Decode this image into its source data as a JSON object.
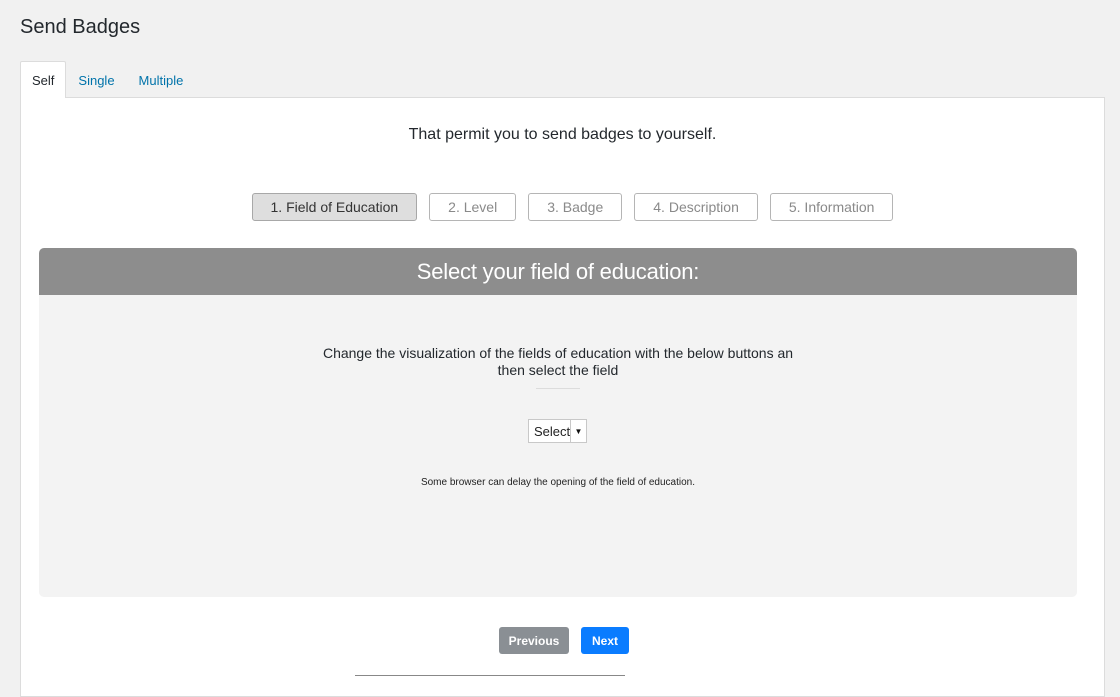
{
  "page": {
    "title": "Send Badges"
  },
  "tabs": [
    {
      "label": "Self",
      "active": true
    },
    {
      "label": "Single",
      "active": false
    },
    {
      "label": "Multiple",
      "active": false
    }
  ],
  "intro": "That permit you to send badges to yourself.",
  "steps": [
    {
      "label": "1. Field of Education",
      "active": true
    },
    {
      "label": "2. Level",
      "active": false
    },
    {
      "label": "3. Badge",
      "active": false
    },
    {
      "label": "4. Description",
      "active": false
    },
    {
      "label": "5. Information",
      "active": false
    }
  ],
  "card": {
    "header": "Select your field of education:",
    "description": "Change the visualization of the fields of education with the below buttons an then select the field",
    "select_value": "Select",
    "note": "Some browser can delay the opening of the field of education."
  },
  "nav": {
    "previous_label": "Previous",
    "next_label": "Next"
  },
  "colors": {
    "background": "#f1f1f1",
    "card_header": "#8d8d8d",
    "next_button": "#0a7cff",
    "previous_button": "#8a8f94",
    "tab_link": "#0073aa"
  }
}
